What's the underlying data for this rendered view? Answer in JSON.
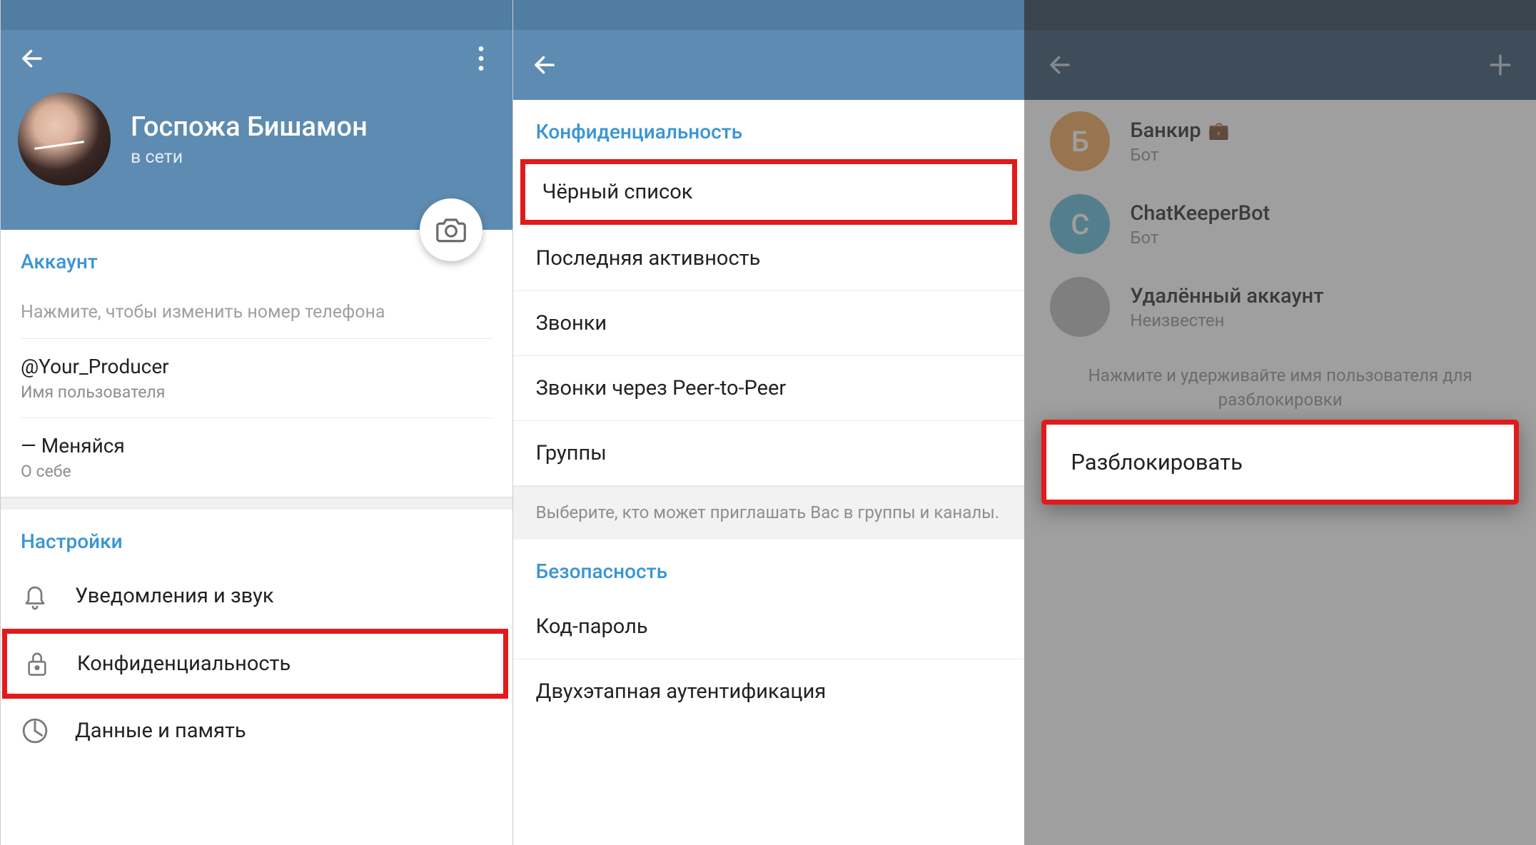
{
  "panel1": {
    "profile": {
      "name": "Госпожа Бишамон",
      "status": "в сети"
    },
    "account_section": "Аккаунт",
    "phone_hint": "Нажмите, чтобы изменить номер телефона",
    "username": {
      "value": "@Your_Producer",
      "label": "Имя пользователя"
    },
    "bio": {
      "value": "— Меняйся",
      "label": "О себе"
    },
    "settings_section": "Настройки",
    "settings": {
      "notifications": "Уведомления и звук",
      "privacy": "Конфиденциальность",
      "data": "Данные и память"
    }
  },
  "panel2": {
    "privacy_section": "Конфиденциальность",
    "items": {
      "blocklist": "Чёрный список",
      "last_seen": "Последняя активность",
      "calls": "Звонки",
      "p2p": "Звонки через Peer-to-Peer",
      "groups": "Группы"
    },
    "groups_hint": "Выберите, кто может приглашать Вас в группы и каналы.",
    "security_section": "Безопасность",
    "security": {
      "passcode": "Код-пароль",
      "twostep": "Двухэтапная аутентификация"
    }
  },
  "panel3": {
    "list": [
      {
        "initial": "Б",
        "name": "Банкир",
        "sub": "Бот",
        "color": "#f0a350",
        "briefcase": true
      },
      {
        "initial": "С",
        "name": "ChatKeeperBot",
        "sub": "Бот",
        "color": "#5bb7d6",
        "briefcase": false
      },
      {
        "initial": "",
        "name": "Удалённый аккаунт",
        "sub": "Неизвестен",
        "color": "#b8b8b8",
        "briefcase": false
      }
    ],
    "hint": "Нажмите и удерживайте имя пользователя для разблокировки",
    "popup": "Разблокировать"
  }
}
